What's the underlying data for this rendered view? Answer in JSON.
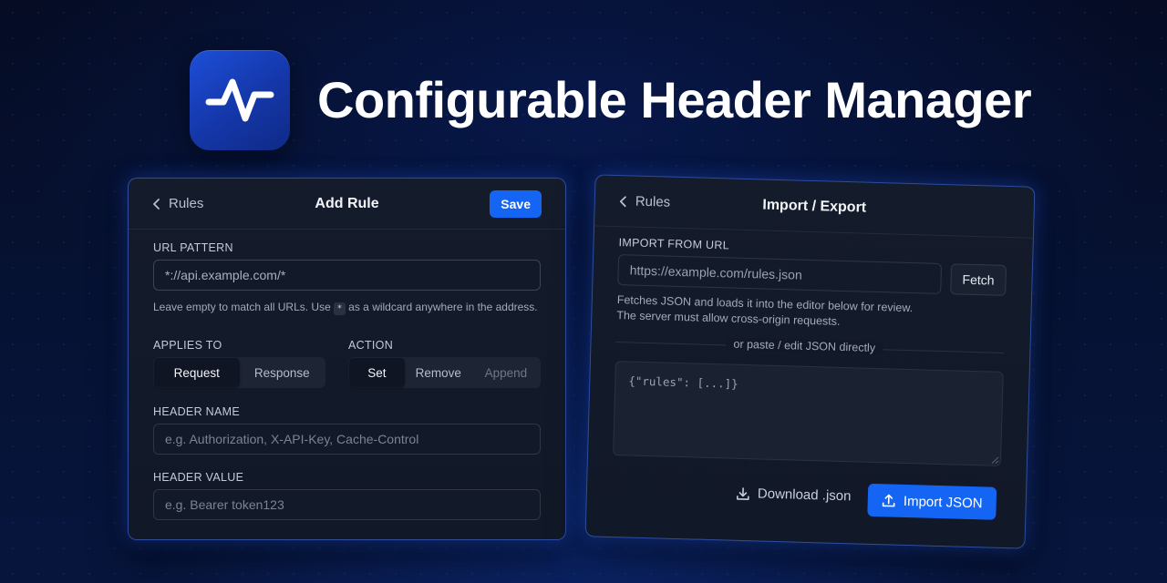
{
  "app": {
    "title": "Configurable Header Manager",
    "icon": "activity-pulse-icon",
    "accent": "#1565f5"
  },
  "add_rule_panel": {
    "back_label": "Rules",
    "title": "Add Rule",
    "save_label": "Save",
    "url_pattern": {
      "label": "URL PATTERN",
      "value": "*://api.example.com/*",
      "hint_before": "Leave empty to match all URLs. Use",
      "hint_kbd": "*",
      "hint_after": "as a wildcard anywhere in the address."
    },
    "applies_to": {
      "label": "APPLIES TO",
      "options": [
        "Request",
        "Response"
      ],
      "selected": "Request"
    },
    "action": {
      "label": "ACTION",
      "options": [
        "Set",
        "Remove",
        "Append"
      ],
      "selected": "Set",
      "disabled": "Append"
    },
    "header_name": {
      "label": "HEADER NAME",
      "placeholder": "e.g. Authorization, X-API-Key, Cache-Control"
    },
    "header_value": {
      "label": "HEADER VALUE",
      "placeholder": "e.g. Bearer token123"
    }
  },
  "import_export_panel": {
    "back_label": "Rules",
    "title": "Import / Export",
    "import_url": {
      "label": "IMPORT FROM URL",
      "value": "https://example.com/rules.json",
      "fetch_label": "Fetch",
      "hint_line1": "Fetches JSON and loads it into the editor below for review.",
      "hint_line2": "The server must allow cross-origin requests."
    },
    "divider_text": "or paste / edit JSON directly",
    "json_editor": {
      "content": "{\"rules\": [...]}"
    },
    "download_label": "Download .json",
    "import_label": "Import JSON"
  }
}
